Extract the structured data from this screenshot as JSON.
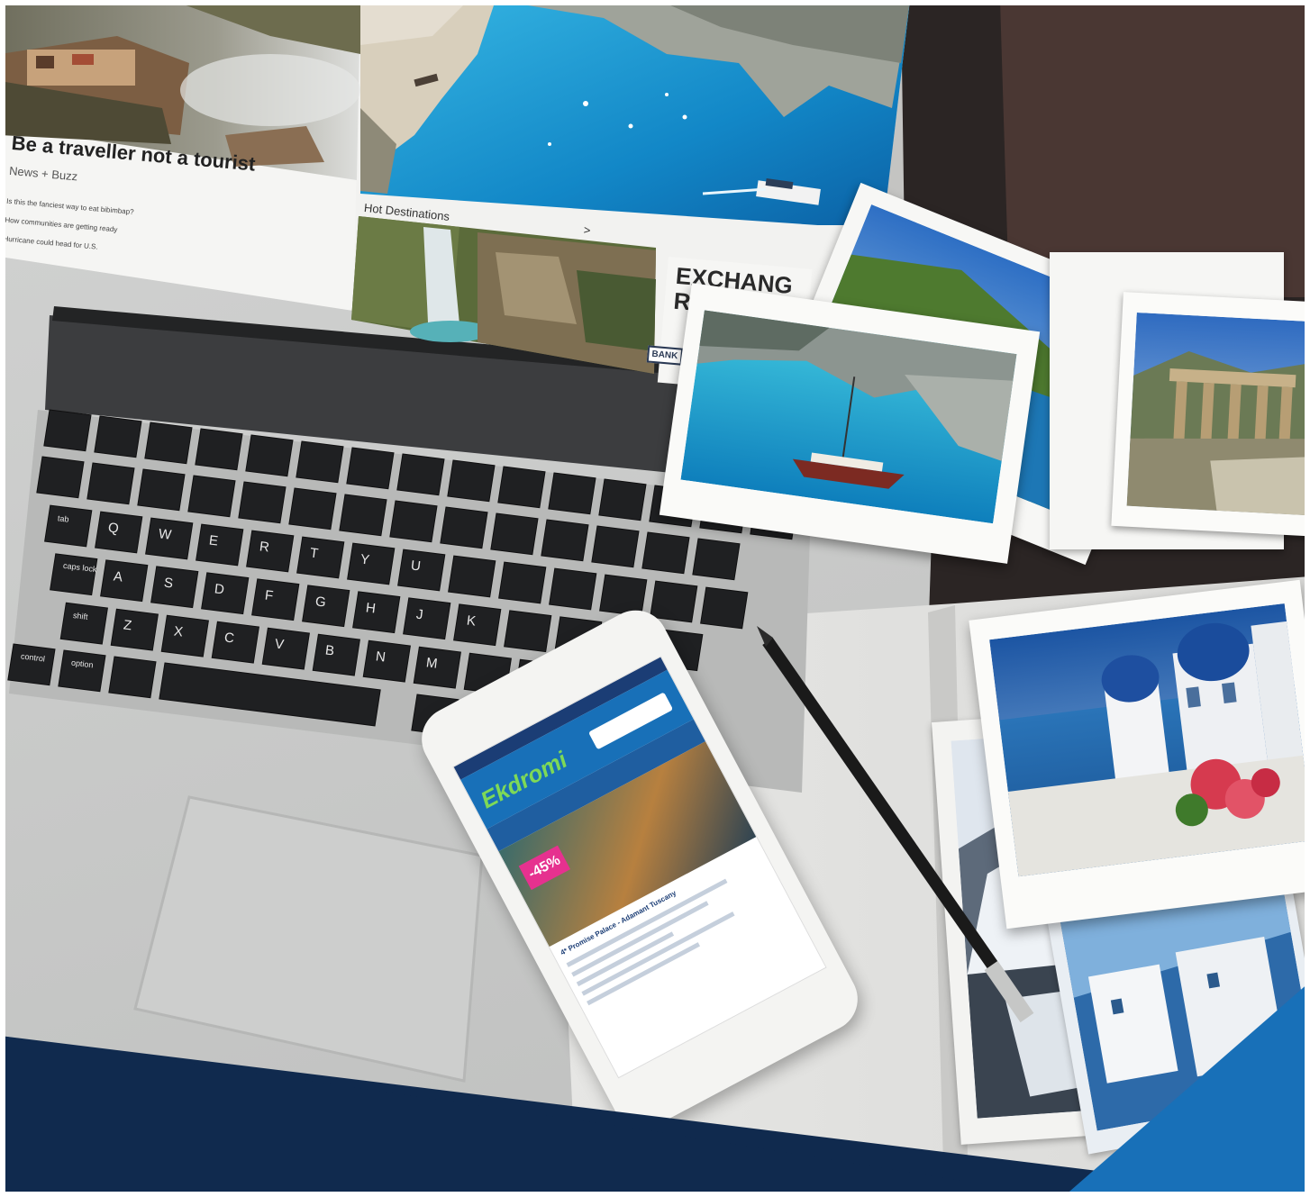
{
  "screen": {
    "article_headline": "Be a traveller not a tourist",
    "article_section": "News + Buzz",
    "article_items": [
      "Is this the fanciest way to eat bibimbap?",
      "How communities are getting ready",
      "Hurricane could head for U.S."
    ],
    "hot_destinations_label": "Hot Destinations",
    "hot_destinations_arrow": ">",
    "exchange_line1": "EXCHANG",
    "exchange_line2": "RATE",
    "exchange_button": "BANK"
  },
  "keyboard": {
    "keys": [
      "tab",
      "caps lock",
      "shift",
      "control",
      "option",
      "Q",
      "W",
      "E",
      "R",
      "T",
      "Y",
      "U",
      "A",
      "S",
      "D",
      "F",
      "G",
      "H",
      "J",
      "K",
      "Z",
      "X",
      "C",
      "V",
      "B",
      "N",
      "M"
    ]
  },
  "phone": {
    "logo": "Ekdromi",
    "badge": "-45%",
    "hotel_title": "4* Promise Palace - Adamant Tuscany"
  },
  "colors": {
    "banner_navy": "#102a4e",
    "accent_blue": "#1870b8",
    "sea": "#1a94cf",
    "discount_pink": "#e6318f"
  }
}
